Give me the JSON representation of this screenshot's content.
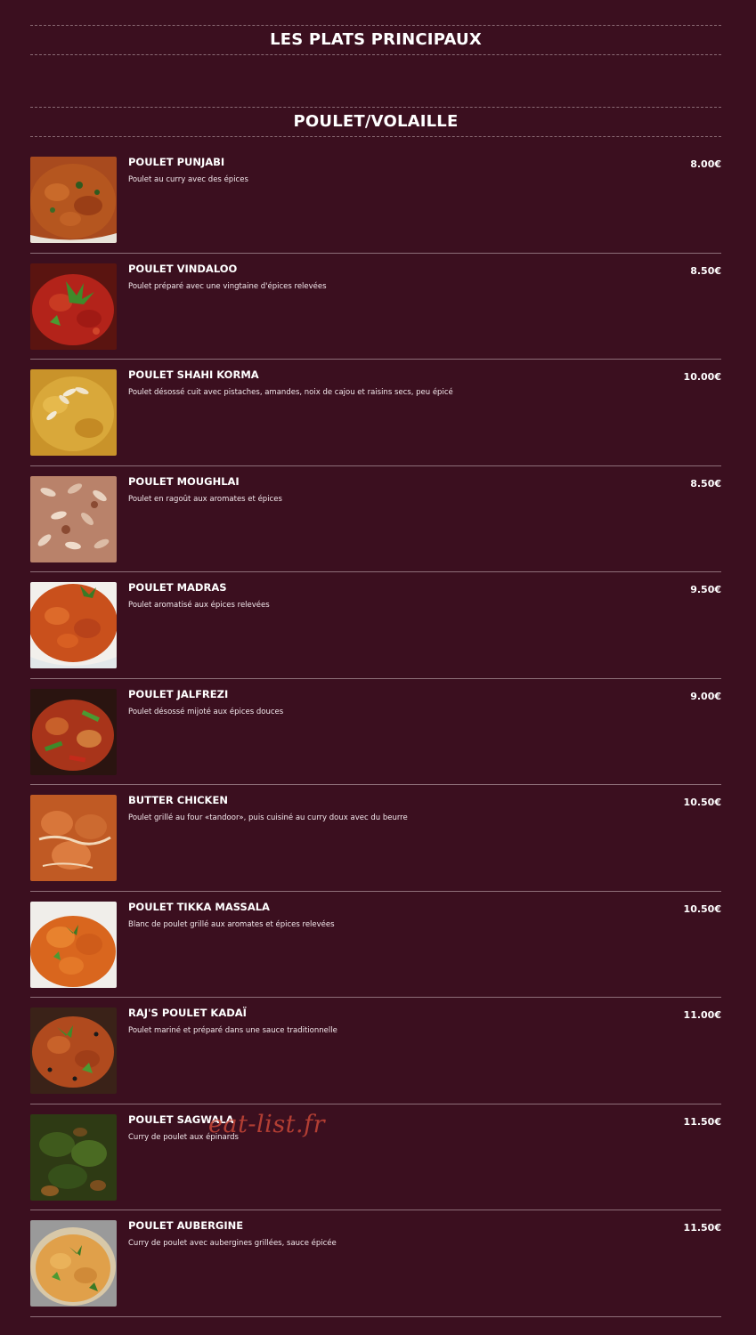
{
  "section_title": "LES PLATS PRINCIPAUX",
  "category_title": "POULET/VOLAILLE",
  "watermark": "eat-list.fr",
  "items": [
    {
      "name": "POULET PUNJABI",
      "desc": "Poulet au curry avec des épices",
      "price": "8.00€",
      "image": "punjabi-curry-photo"
    },
    {
      "name": "POULET VINDALOO",
      "desc": "Poulet préparé avec une vingtaine d'épices relevées",
      "price": "8.50€",
      "image": "vindaloo-curry-photo"
    },
    {
      "name": "POULET SHAHI KORMA",
      "desc": "Poulet désossé cuit avec pistaches, amandes, noix de cajou et raisins secs, peu épicé",
      "price": "10.00€",
      "image": "korma-curry-photo"
    },
    {
      "name": "POULET MOUGHLAI",
      "desc": "Poulet en ragoût aux aromates et épices",
      "price": "8.50€",
      "image": "moughlai-curry-photo"
    },
    {
      "name": "POULET MADRAS",
      "desc": "Poulet aromatisé aux épices relevées",
      "price": "9.50€",
      "image": "madras-curry-photo"
    },
    {
      "name": "POULET JALFREZI",
      "desc": "Poulet désossé mijoté aux épices douces",
      "price": "9.00€",
      "image": "jalfrezi-curry-photo"
    },
    {
      "name": "BUTTER CHICKEN",
      "desc": "Poulet grillé au four «tandoor», puis cuisiné au curry doux avec du beurre",
      "price": "10.50€",
      "image": "butter-chicken-photo"
    },
    {
      "name": "POULET TIKKA MASSALA",
      "desc": "Blanc de poulet grillé aux aromates et épices relevées",
      "price": "10.50€",
      "image": "tikka-massala-photo"
    },
    {
      "name": "RAJ'S POULET KADAÏ",
      "desc": "Poulet mariné et préparé dans une sauce traditionnelle",
      "price": "11.00€",
      "image": "kadai-curry-photo"
    },
    {
      "name": "POULET SAGWALA",
      "desc": "Curry de poulet aux épinards",
      "price": "11.50€",
      "image": "sagwala-curry-photo"
    },
    {
      "name": "POULET AUBERGINE",
      "desc": "Curry de poulet avec aubergines grillées, sauce épicée",
      "price": "11.50€",
      "image": "aubergine-curry-photo"
    }
  ]
}
